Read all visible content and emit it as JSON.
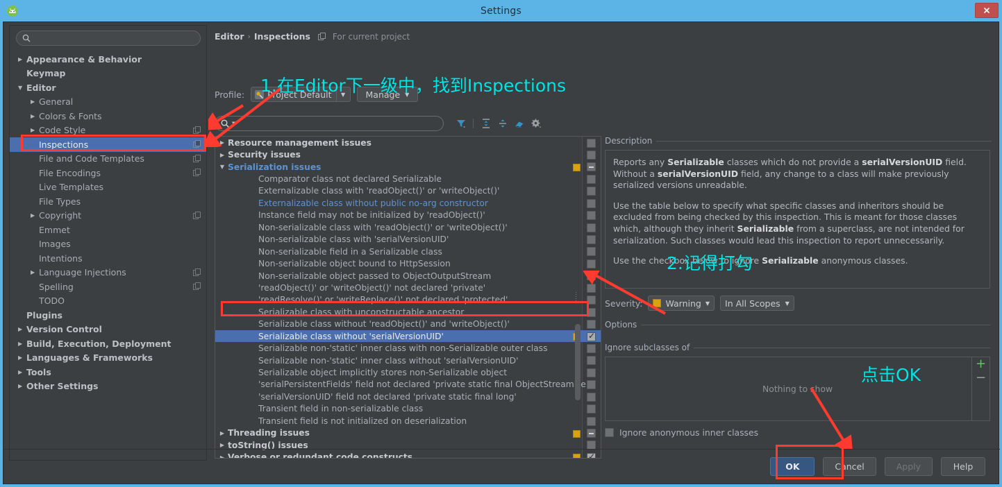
{
  "window": {
    "title": "Settings",
    "close_label": "✕",
    "app_icon": "android-studio-icon"
  },
  "sidebar": {
    "search_placeholder": "",
    "search_value": "",
    "items": [
      {
        "label": "Appearance & Behavior",
        "level": 0,
        "arrow": "▶",
        "selected": false,
        "copy": false
      },
      {
        "label": "Keymap",
        "level": 0,
        "arrow": "",
        "selected": false,
        "copy": false
      },
      {
        "label": "Editor",
        "level": 0,
        "arrow": "▼",
        "selected": false,
        "copy": false
      },
      {
        "label": "General",
        "level": 1,
        "arrow": "▶",
        "selected": false,
        "copy": false
      },
      {
        "label": "Colors & Fonts",
        "level": 1,
        "arrow": "▶",
        "selected": false,
        "copy": false
      },
      {
        "label": "Code Style",
        "level": 1,
        "arrow": "▶",
        "selected": false,
        "copy": true
      },
      {
        "label": "Inspections",
        "level": 1,
        "arrow": "",
        "selected": true,
        "copy": true
      },
      {
        "label": "File and Code Templates",
        "level": 1,
        "arrow": "",
        "selected": false,
        "copy": true
      },
      {
        "label": "File Encodings",
        "level": 1,
        "arrow": "",
        "selected": false,
        "copy": true
      },
      {
        "label": "Live Templates",
        "level": 1,
        "arrow": "",
        "selected": false,
        "copy": false
      },
      {
        "label": "File Types",
        "level": 1,
        "arrow": "",
        "selected": false,
        "copy": false
      },
      {
        "label": "Copyright",
        "level": 1,
        "arrow": "▶",
        "selected": false,
        "copy": true
      },
      {
        "label": "Emmet",
        "level": 1,
        "arrow": "",
        "selected": false,
        "copy": false
      },
      {
        "label": "Images",
        "level": 1,
        "arrow": "",
        "selected": false,
        "copy": false
      },
      {
        "label": "Intentions",
        "level": 1,
        "arrow": "",
        "selected": false,
        "copy": false
      },
      {
        "label": "Language Injections",
        "level": 1,
        "arrow": "▶",
        "selected": false,
        "copy": true
      },
      {
        "label": "Spelling",
        "level": 1,
        "arrow": "",
        "selected": false,
        "copy": true
      },
      {
        "label": "TODO",
        "level": 1,
        "arrow": "",
        "selected": false,
        "copy": false
      },
      {
        "label": "Plugins",
        "level": 0,
        "arrow": "",
        "selected": false,
        "copy": false
      },
      {
        "label": "Version Control",
        "level": 0,
        "arrow": "▶",
        "selected": false,
        "copy": false
      },
      {
        "label": "Build, Execution, Deployment",
        "level": 0,
        "arrow": "▶",
        "selected": false,
        "copy": false
      },
      {
        "label": "Languages & Frameworks",
        "level": 0,
        "arrow": "▶",
        "selected": false,
        "copy": false
      },
      {
        "label": "Tools",
        "level": 0,
        "arrow": "▶",
        "selected": false,
        "copy": false
      },
      {
        "label": "Other Settings",
        "level": 0,
        "arrow": "▶",
        "selected": false,
        "copy": false
      }
    ]
  },
  "main": {
    "breadcrumb": {
      "root": "Editor",
      "separator": "›",
      "leaf": "Inspections",
      "scope_note": "For current project"
    },
    "profile": {
      "label": "Profile:",
      "value": "Project Default",
      "caret": "▼",
      "manage_label": "Manage",
      "manage_caret": "▼"
    },
    "filter": {
      "placeholder": "",
      "value": "",
      "toolbar_icons": [
        "filter-icon",
        "expand-all-icon",
        "collapse-all-icon",
        "reset-icon",
        "gear-icon"
      ]
    },
    "tree": [
      {
        "label": "Resource management issues",
        "type": "group",
        "arrow": "▶",
        "open": false,
        "severity": false,
        "check": "none"
      },
      {
        "label": "Security issues",
        "type": "group",
        "arrow": "▶",
        "open": false,
        "severity": false,
        "check": "none"
      },
      {
        "label": "Serialization issues",
        "type": "group",
        "arrow": "▼",
        "open": true,
        "severity": true,
        "check": "partial"
      },
      {
        "label": "Comparator class not declared Serializable",
        "type": "leaf",
        "link": false,
        "severity": false,
        "check": "none"
      },
      {
        "label": "Externalizable class with 'readObject()' or 'writeObject()'",
        "type": "leaf",
        "link": false,
        "severity": false,
        "check": "none"
      },
      {
        "label": "Externalizable class without public no-arg constructor",
        "type": "leaf",
        "link": true,
        "severity": false,
        "check": "none"
      },
      {
        "label": "Instance field may not be initialized by 'readObject()'",
        "type": "leaf",
        "link": false,
        "severity": false,
        "check": "none"
      },
      {
        "label": "Non-serializable class with 'readObject()' or 'writeObject()'",
        "type": "leaf",
        "link": false,
        "severity": false,
        "check": "none"
      },
      {
        "label": "Non-serializable class with 'serialVersionUID'",
        "type": "leaf",
        "link": false,
        "severity": false,
        "check": "none"
      },
      {
        "label": "Non-serializable field in a Serializable class",
        "type": "leaf",
        "link": false,
        "severity": false,
        "check": "none"
      },
      {
        "label": "Non-serializable object bound to HttpSession",
        "type": "leaf",
        "link": false,
        "severity": false,
        "check": "none"
      },
      {
        "label": "Non-serializable object passed to ObjectOutputStream",
        "type": "leaf",
        "link": false,
        "severity": false,
        "check": "none"
      },
      {
        "label": "'readObject()' or 'writeObject()' not declared 'private'",
        "type": "leaf",
        "link": false,
        "severity": false,
        "check": "none"
      },
      {
        "label": "'readResolve()' or 'writeReplace()' not declared 'protected'",
        "type": "leaf",
        "link": false,
        "severity": false,
        "check": "none"
      },
      {
        "label": "Serializable class with unconstructable ancestor",
        "type": "leaf",
        "link": false,
        "severity": false,
        "check": "none"
      },
      {
        "label": "Serializable class without 'readObject()' and 'writeObject()'",
        "type": "leaf",
        "link": false,
        "severity": false,
        "check": "none"
      },
      {
        "label": "Serializable class without 'serialVersionUID'",
        "type": "leaf",
        "link": false,
        "severity": true,
        "check": "checked",
        "selected": true
      },
      {
        "label": "Serializable non-'static' inner class with non-Serializable outer class",
        "type": "leaf",
        "link": false,
        "severity": false,
        "check": "none"
      },
      {
        "label": "Serializable non-'static' inner class without 'serialVersionUID'",
        "type": "leaf",
        "link": false,
        "severity": false,
        "check": "none"
      },
      {
        "label": "Serializable object implicitly stores non-Serializable object",
        "type": "leaf",
        "link": false,
        "severity": false,
        "check": "none"
      },
      {
        "label": "'serialPersistentFields' field not declared 'private static final ObjectStreamFie",
        "type": "leaf",
        "link": false,
        "severity": false,
        "check": "none"
      },
      {
        "label": "'serialVersionUID' field not declared 'private static final long'",
        "type": "leaf",
        "link": false,
        "severity": false,
        "check": "none"
      },
      {
        "label": "Transient field in non-serializable class",
        "type": "leaf",
        "link": false,
        "severity": false,
        "check": "none"
      },
      {
        "label": "Transient field is not initialized on deserialization",
        "type": "leaf",
        "link": false,
        "severity": false,
        "check": "none"
      },
      {
        "label": "Threading issues",
        "type": "group",
        "arrow": "▶",
        "open": false,
        "severity": true,
        "check": "partial"
      },
      {
        "label": "toString() issues",
        "type": "group",
        "arrow": "▶",
        "open": false,
        "severity": false,
        "check": "none"
      },
      {
        "label": "Verbose or redundant code constructs",
        "type": "group",
        "arrow": "▶",
        "open": false,
        "severity": true,
        "check": "checked"
      }
    ]
  },
  "right": {
    "description_title": "Description",
    "description_paragraphs": [
      "Reports any Serializable classes which do not provide a serialVersionUID field. Without a serialVersionUID field, any change to a class will make previously serialized versions unreadable.",
      "Use the table below to specify what specific classes and inheritors should be excluded from being checked by this inspection. This is meant for those classes which, although they inherit Serializable from a superclass, are not intended for serialization. Such classes would lead this inspection to report unnecessarily.",
      "Use the checkbox below to ignore Serializable anonymous classes."
    ],
    "severity_label": "Severity:",
    "severity_value": "Warning",
    "severity_caret": "▼",
    "scope_value": "In All Scopes",
    "scope_caret": "▼",
    "options_title": "Options",
    "ignore_subclasses_title": "Ignore subclasses of",
    "list_empty_text": "Nothing to show",
    "add_label": "+",
    "remove_label": "−",
    "ignore_anon_label": "Ignore anonymous inner classes",
    "ignore_anon_checked": false
  },
  "footer": {
    "buttons": [
      {
        "label": "OK",
        "style": "primary",
        "enabled": true
      },
      {
        "label": "Cancel",
        "style": "normal",
        "enabled": true
      },
      {
        "label": "Apply",
        "style": "disabled",
        "enabled": false
      },
      {
        "label": "Help",
        "style": "normal",
        "enabled": true
      }
    ]
  },
  "annotations": {
    "step1": "1.在Editor下一级中，找到Inspections",
    "step2": "2.记得打勾",
    "step3": "点击OK",
    "accent_color": "#00e5e5",
    "highlight_color": "#ff3b30"
  },
  "colors": {
    "titlebar": "#5bb4e5",
    "panel_bg": "#3c3f41",
    "selection": "#4b6eaf",
    "link": "#5b93d6",
    "severity_warning": "#d9a211",
    "primary_button": "#365880"
  }
}
